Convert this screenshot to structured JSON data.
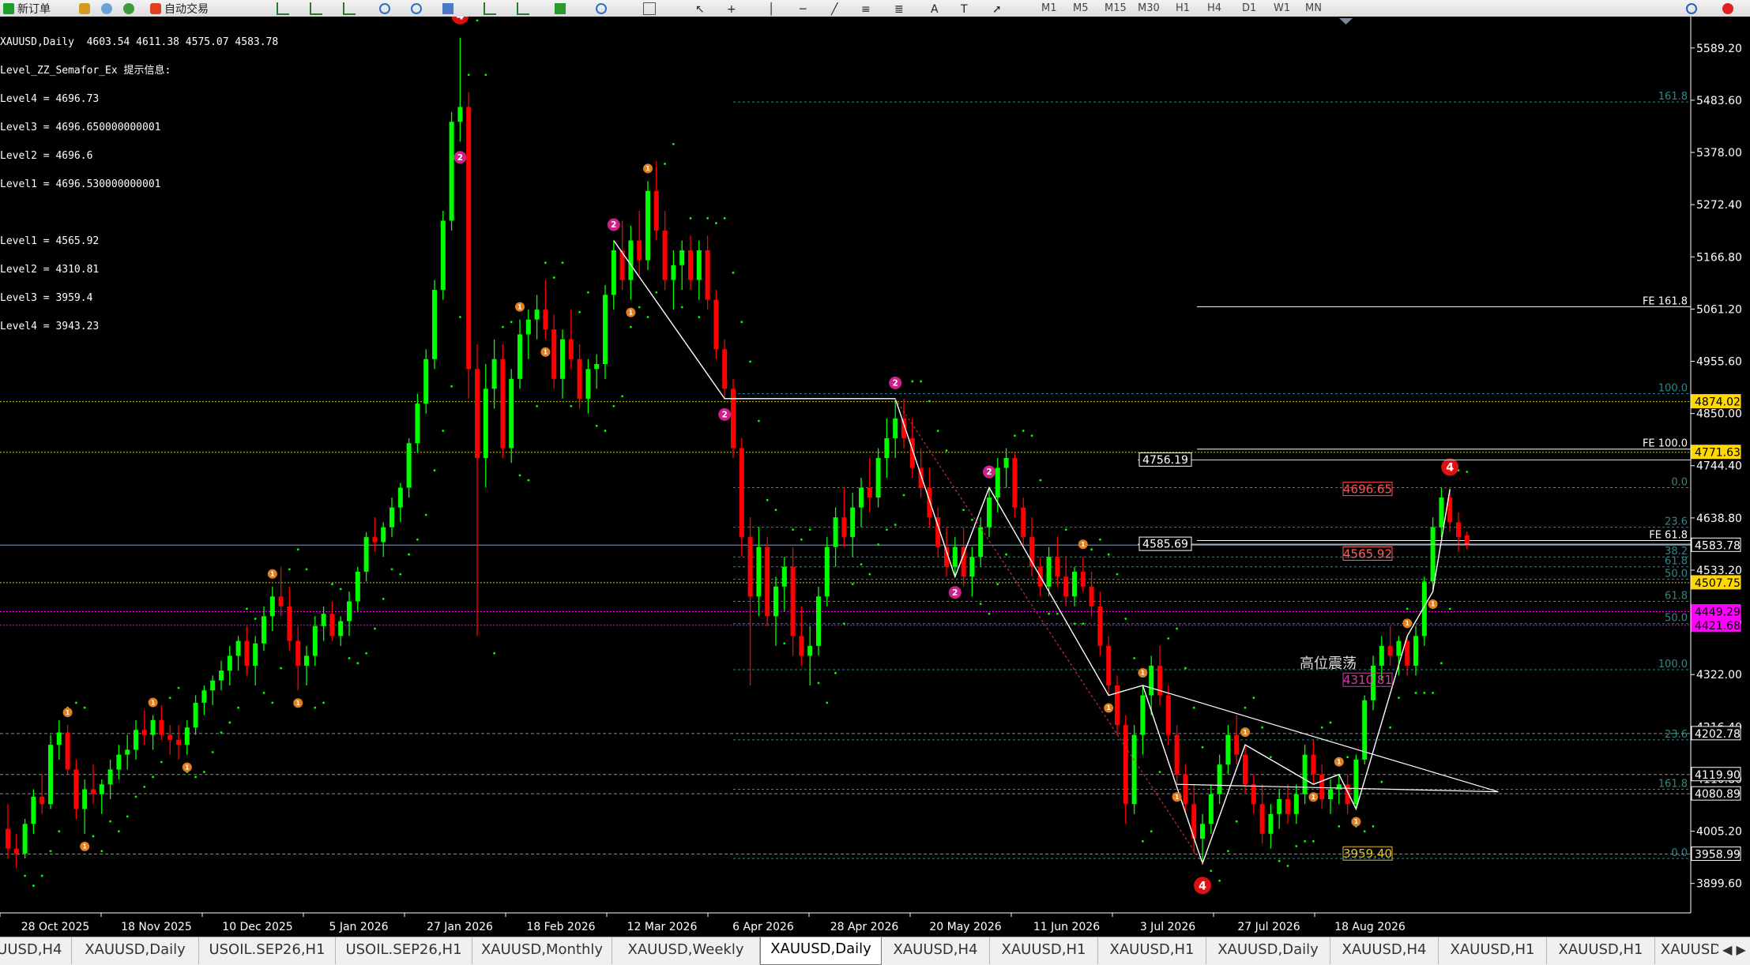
{
  "toolbar": {
    "new_order_label": "新订单",
    "auto_trading_label": "自动交易",
    "timeframes": [
      "M1",
      "M5",
      "M15",
      "M30",
      "H1",
      "H4",
      "D1",
      "W1",
      "MN"
    ]
  },
  "info": {
    "header": "XAUUSD,Daily  4603.54 4611.38 4575.07 4583.78",
    "indicator_title": "Level_ZZ_Semafor_Ex 提示信息:",
    "lines": [
      "Level4 = 4696.73",
      "Level3 = 4696.650000000001",
      "Level2 = 4696.6",
      "Level1 = 4696.530000000001",
      "",
      "Level1 = 4565.92",
      "Level2 = 4310.81",
      "Level3 = 3959.4",
      "Level4 = 3943.23"
    ]
  },
  "chart_data": {
    "type": "candlestick",
    "symbol": "XAUUSD",
    "timeframe": "Daily",
    "ohlc_current": {
      "open": 4603.54,
      "high": 4611.38,
      "low": 4575.07,
      "close": 4583.78
    },
    "ylim": [
      3840,
      5640
    ],
    "price_axis_ticks": [
      5589.2,
      5483.6,
      5378.0,
      5272.4,
      5166.8,
      5061.2,
      4955.6,
      4850.0,
      4744.4,
      4638.8,
      4533.2,
      4427.6,
      4322.0,
      4216.4,
      4110.8,
      4005.2,
      3899.6
    ],
    "time_axis_labels": [
      "28 Oct 2025",
      "18 Nov 2025",
      "10 Dec 2025",
      "5 Jan 2026",
      "27 Jan 2026",
      "18 Feb 2026",
      "12 Mar 2026",
      "6 Apr 2026",
      "28 Apr 2026",
      "20 May 2026",
      "11 Jun 2026",
      "3 Jul 2026",
      "27 Jul 2026",
      "18 Aug 2026"
    ],
    "candles": [
      [
        4010,
        4060,
        3950,
        3970
      ],
      [
        3970,
        4000,
        3930,
        3960
      ],
      [
        3960,
        4030,
        3950,
        4020
      ],
      [
        4020,
        4090,
        4000,
        4075
      ],
      [
        4075,
        4120,
        4040,
        4060
      ],
      [
        4060,
        4200,
        4050,
        4180
      ],
      [
        4180,
        4230,
        4150,
        4205
      ],
      [
        4205,
        4220,
        4120,
        4130
      ],
      [
        4130,
        4150,
        4030,
        4050
      ],
      [
        4050,
        4110,
        4000,
        4090
      ],
      [
        4090,
        4140,
        4060,
        4080
      ],
      [
        4080,
        4110,
        4040,
        4100
      ],
      [
        4100,
        4150,
        4070,
        4130
      ],
      [
        4130,
        4180,
        4110,
        4160
      ],
      [
        4160,
        4200,
        4130,
        4170
      ],
      [
        4170,
        4230,
        4150,
        4210
      ],
      [
        4210,
        4250,
        4180,
        4200
      ],
      [
        4200,
        4240,
        4170,
        4230
      ],
      [
        4230,
        4260,
        4190,
        4200
      ],
      [
        4200,
        4220,
        4160,
        4190
      ],
      [
        4190,
        4220,
        4150,
        4180
      ],
      [
        4180,
        4230,
        4160,
        4215
      ],
      [
        4215,
        4280,
        4200,
        4265
      ],
      [
        4265,
        4300,
        4240,
        4290
      ],
      [
        4290,
        4320,
        4260,
        4310
      ],
      [
        4310,
        4350,
        4290,
        4330
      ],
      [
        4330,
        4380,
        4300,
        4360
      ],
      [
        4360,
        4400,
        4330,
        4390
      ],
      [
        4390,
        4420,
        4320,
        4340
      ],
      [
        4340,
        4400,
        4300,
        4385
      ],
      [
        4385,
        4460,
        4370,
        4440
      ],
      [
        4440,
        4500,
        4410,
        4480
      ],
      [
        4480,
        4540,
        4440,
        4460
      ],
      [
        4460,
        4500,
        4370,
        4390
      ],
      [
        4390,
        4420,
        4290,
        4340
      ],
      [
        4340,
        4380,
        4300,
        4360
      ],
      [
        4360,
        4440,
        4340,
        4420
      ],
      [
        4420,
        4460,
        4390,
        4445
      ],
      [
        4445,
        4470,
        4390,
        4400
      ],
      [
        4400,
        4440,
        4380,
        4430
      ],
      [
        4430,
        4490,
        4400,
        4470
      ],
      [
        4470,
        4540,
        4450,
        4530
      ],
      [
        4530,
        4610,
        4510,
        4600
      ],
      [
        4600,
        4640,
        4570,
        4590
      ],
      [
        4590,
        4630,
        4560,
        4620
      ],
      [
        4620,
        4680,
        4600,
        4660
      ],
      [
        4660,
        4710,
        4630,
        4700
      ],
      [
        4700,
        4800,
        4680,
        4790
      ],
      [
        4790,
        4890,
        4770,
        4870
      ],
      [
        4870,
        4980,
        4850,
        4960
      ],
      [
        4960,
        5120,
        4940,
        5100
      ],
      [
        5100,
        5260,
        5080,
        5240
      ],
      [
        5240,
        5460,
        5220,
        5440
      ],
      [
        5440,
        5610,
        5400,
        5470
      ],
      [
        5470,
        5500,
        4880,
        4940
      ],
      [
        4940,
        4990,
        4400,
        4760
      ],
      [
        4760,
        4950,
        4700,
        4900
      ],
      [
        4900,
        5000,
        4860,
        4960
      ],
      [
        4960,
        4990,
        4760,
        4780
      ],
      [
        4780,
        4940,
        4750,
        4920
      ],
      [
        4920,
        5040,
        4900,
        5010
      ],
      [
        5010,
        5060,
        4960,
        5040
      ],
      [
        5040,
        5090,
        5000,
        5060
      ],
      [
        5060,
        5120,
        5000,
        5020
      ],
      [
        5020,
        5050,
        4900,
        4920
      ],
      [
        4920,
        5020,
        4880,
        5000
      ],
      [
        5000,
        5060,
        4940,
        4960
      ],
      [
        4960,
        4990,
        4860,
        4880
      ],
      [
        4880,
        4960,
        4850,
        4940
      ],
      [
        4940,
        4970,
        4900,
        4950
      ],
      [
        4950,
        5110,
        4920,
        5090
      ],
      [
        5090,
        5200,
        5060,
        5180
      ],
      [
        5180,
        5240,
        5100,
        5120
      ],
      [
        5120,
        5230,
        5080,
        5200
      ],
      [
        5200,
        5260,
        5130,
        5160
      ],
      [
        5160,
        5320,
        5140,
        5300
      ],
      [
        5300,
        5360,
        5200,
        5220
      ],
      [
        5220,
        5260,
        5100,
        5120
      ],
      [
        5120,
        5180,
        5060,
        5150
      ],
      [
        5150,
        5200,
        5100,
        5180
      ],
      [
        5180,
        5210,
        5100,
        5120
      ],
      [
        5120,
        5200,
        5080,
        5180
      ],
      [
        5180,
        5210,
        5060,
        5080
      ],
      [
        5080,
        5100,
        4960,
        4980
      ],
      [
        4980,
        5000,
        4880,
        4900
      ],
      [
        4900,
        4920,
        4760,
        4780
      ],
      [
        4780,
        4800,
        4560,
        4600
      ],
      [
        4600,
        4640,
        4300,
        4480
      ],
      [
        4480,
        4620,
        4440,
        4580
      ],
      [
        4580,
        4600,
        4420,
        4440
      ],
      [
        4440,
        4520,
        4380,
        4500
      ],
      [
        4500,
        4560,
        4450,
        4540
      ],
      [
        4540,
        4580,
        4360,
        4400
      ],
      [
        4400,
        4460,
        4340,
        4360
      ],
      [
        4360,
        4420,
        4300,
        4380
      ],
      [
        4380,
        4500,
        4360,
        4480
      ],
      [
        4480,
        4600,
        4460,
        4580
      ],
      [
        4580,
        4660,
        4540,
        4640
      ],
      [
        4640,
        4700,
        4580,
        4600
      ],
      [
        4600,
        4690,
        4560,
        4660
      ],
      [
        4660,
        4720,
        4620,
        4700
      ],
      [
        4700,
        4760,
        4650,
        4680
      ],
      [
        4680,
        4780,
        4660,
        4760
      ],
      [
        4760,
        4840,
        4720,
        4800
      ],
      [
        4800,
        4880,
        4760,
        4840
      ],
      [
        4840,
        4880,
        4780,
        4800
      ],
      [
        4800,
        4840,
        4720,
        4740
      ],
      [
        4740,
        4780,
        4680,
        4700
      ],
      [
        4700,
        4740,
        4620,
        4640
      ],
      [
        4640,
        4660,
        4560,
        4580
      ],
      [
        4580,
        4620,
        4520,
        4540
      ],
      [
        4540,
        4600,
        4520,
        4580
      ],
      [
        4580,
        4620,
        4500,
        4520
      ],
      [
        4520,
        4580,
        4480,
        4560
      ],
      [
        4560,
        4640,
        4540,
        4620
      ],
      [
        4620,
        4700,
        4600,
        4680
      ],
      [
        4680,
        4760,
        4650,
        4740
      ],
      [
        4740,
        4780,
        4700,
        4760
      ],
      [
        4760,
        4770,
        4640,
        4660
      ],
      [
        4660,
        4680,
        4580,
        4600
      ],
      [
        4600,
        4640,
        4520,
        4540
      ],
      [
        4540,
        4560,
        4480,
        4500
      ],
      [
        4500,
        4580,
        4480,
        4560
      ],
      [
        4560,
        4600,
        4500,
        4520
      ],
      [
        4520,
        4560,
        4460,
        4480
      ],
      [
        4480,
        4540,
        4460,
        4530
      ],
      [
        4530,
        4560,
        4490,
        4500
      ],
      [
        4500,
        4530,
        4440,
        4460
      ],
      [
        4460,
        4490,
        4360,
        4380
      ],
      [
        4380,
        4400,
        4280,
        4300
      ],
      [
        4300,
        4320,
        4200,
        4220
      ],
      [
        4220,
        4240,
        4020,
        4060
      ],
      [
        4060,
        4220,
        4040,
        4200
      ],
      [
        4200,
        4300,
        4160,
        4280
      ],
      [
        4280,
        4360,
        4240,
        4340
      ],
      [
        4340,
        4380,
        4260,
        4280
      ],
      [
        4280,
        4300,
        4180,
        4200
      ],
      [
        4200,
        4220,
        4100,
        4120
      ],
      [
        4120,
        4140,
        4040,
        4060
      ],
      [
        4060,
        4100,
        3960,
        3990
      ],
      [
        3990,
        4040,
        3940,
        4020
      ],
      [
        4020,
        4100,
        4000,
        4080
      ],
      [
        4080,
        4160,
        4060,
        4140
      ],
      [
        4140,
        4220,
        4120,
        4200
      ],
      [
        4200,
        4240,
        4140,
        4160
      ],
      [
        4160,
        4180,
        4080,
        4100
      ],
      [
        4100,
        4120,
        4040,
        4060
      ],
      [
        4060,
        4100,
        3980,
        4000
      ],
      [
        4000,
        4060,
        3970,
        4040
      ],
      [
        4040,
        4090,
        4010,
        4070
      ],
      [
        4070,
        4100,
        4020,
        4040
      ],
      [
        4040,
        4100,
        4020,
        4080
      ],
      [
        4080,
        4180,
        4060,
        4160
      ],
      [
        4160,
        4190,
        4100,
        4120
      ],
      [
        4120,
        4140,
        4050,
        4070
      ],
      [
        4070,
        4110,
        4040,
        4090
      ],
      [
        4090,
        4120,
        4060,
        4100
      ],
      [
        4100,
        4120,
        4040,
        4060
      ],
      [
        4060,
        4160,
        4050,
        4150
      ],
      [
        4150,
        4280,
        4140,
        4270
      ],
      [
        4270,
        4360,
        4250,
        4340
      ],
      [
        4340,
        4400,
        4310,
        4380
      ],
      [
        4380,
        4420,
        4340,
        4360
      ],
      [
        4360,
        4400,
        4320,
        4390
      ],
      [
        4390,
        4400,
        4320,
        4340
      ],
      [
        4340,
        4420,
        4320,
        4400
      ],
      [
        4400,
        4520,
        4380,
        4510
      ],
      [
        4510,
        4640,
        4490,
        4620
      ],
      [
        4620,
        4700,
        4600,
        4680
      ],
      [
        4680,
        4697,
        4610,
        4630
      ],
      [
        4630,
        4650,
        4570,
        4600
      ],
      [
        4603.54,
        4611.38,
        4575.07,
        4583.78
      ]
    ],
    "horizontal_lines": [
      {
        "price": 4874.02,
        "label": "4874.02",
        "type": "resistance"
      },
      {
        "price": 4771.63,
        "label": "4771.63",
        "type": "resistance"
      },
      {
        "price": 4583.78,
        "label": "4583.78",
        "type": "bid"
      },
      {
        "price": 4507.75,
        "label": "4507.75",
        "type": "support"
      },
      {
        "price": 4449.29,
        "label": "4449.29",
        "type": "support-magenta"
      },
      {
        "price": 4421.68,
        "label": "4421.68",
        "type": "support-magenta"
      },
      {
        "price": 4202.78,
        "label": "4202.78",
        "type": "plain"
      },
      {
        "price": 4119.9,
        "label": "4119.90",
        "type": "plain"
      },
      {
        "price": 4080.89,
        "label": "4080.89",
        "type": "plain"
      },
      {
        "price": 3958.99,
        "label": "3958.99",
        "type": "plain"
      }
    ],
    "fib_levels": [
      {
        "price": 5480,
        "label": "161.8"
      },
      {
        "price": 4890,
        "label": "100.0"
      },
      {
        "price": 4700,
        "label": "0.0"
      },
      {
        "price": 4620,
        "label": "23.6"
      },
      {
        "price": 4560,
        "label": "38.2"
      },
      {
        "price": 4540,
        "label": "61.8"
      },
      {
        "price": 4515,
        "label": "50.0"
      },
      {
        "price": 4470,
        "label": "61.8"
      },
      {
        "price": 4425,
        "label": "50.0"
      },
      {
        "price": 4332,
        "label": "100.0"
      },
      {
        "price": 4190,
        "label": "23.6"
      },
      {
        "price": 4090,
        "label": "161.8"
      },
      {
        "price": 3950,
        "label": "0.0"
      }
    ],
    "fe_levels": [
      {
        "price": 5066,
        "label": "FE 161.8"
      },
      {
        "price": 4778,
        "label": "FE 100.0"
      },
      {
        "price": 4593,
        "label": "FE 61.8"
      }
    ],
    "price_boxes": [
      {
        "price": 4756.19,
        "label": "4756.19"
      },
      {
        "price": 4585.69,
        "label": "4585.69"
      }
    ],
    "semafor_level_labels": [
      {
        "label": "4696.65",
        "price": 4696.65
      },
      {
        "label": "4565.92",
        "price": 4565.92
      },
      {
        "label": "4310.81",
        "price": 4310.81
      },
      {
        "label": "3959.40",
        "price": 3959.4
      }
    ],
    "annotation": "高位震荡",
    "semafor_markers": [
      {
        "i": 53,
        "pos": "high",
        "level": "4"
      },
      {
        "i": 53,
        "pos": "low",
        "level": "2"
      },
      {
        "i": 71,
        "pos": "high",
        "level": "2"
      },
      {
        "i": 84,
        "pos": "low",
        "level": "2"
      },
      {
        "i": 104,
        "pos": "high",
        "level": "2"
      },
      {
        "i": 111,
        "pos": "low",
        "level": "2"
      },
      {
        "i": 115,
        "pos": "high",
        "level": "2"
      },
      {
        "i": 140,
        "pos": "low",
        "level": "4"
      },
      {
        "i": 169,
        "pos": "high",
        "level": "4"
      },
      {
        "i": 7,
        "pos": "high",
        "level": "1"
      },
      {
        "i": 9,
        "pos": "low",
        "level": "1"
      },
      {
        "i": 17,
        "pos": "high",
        "level": "1"
      },
      {
        "i": 21,
        "pos": "low",
        "level": "1"
      },
      {
        "i": 31,
        "pos": "high",
        "level": "1"
      },
      {
        "i": 34,
        "pos": "low",
        "level": "1"
      },
      {
        "i": 60,
        "pos": "high",
        "level": "1"
      },
      {
        "i": 63,
        "pos": "low",
        "level": "1"
      },
      {
        "i": 73,
        "pos": "low",
        "level": "1"
      },
      {
        "i": 75,
        "pos": "high",
        "level": "1"
      },
      {
        "i": 126,
        "pos": "high",
        "level": "1"
      },
      {
        "i": 129,
        "pos": "low",
        "level": "1"
      },
      {
        "i": 133,
        "pos": "high",
        "level": "1"
      },
      {
        "i": 137,
        "pos": "low",
        "level": "1"
      },
      {
        "i": 145,
        "pos": "high",
        "level": "1"
      },
      {
        "i": 153,
        "pos": "low",
        "level": "1"
      },
      {
        "i": 156,
        "pos": "high",
        "level": "1"
      },
      {
        "i": 158,
        "pos": "low",
        "level": "1"
      },
      {
        "i": 164,
        "pos": "high",
        "level": "1"
      },
      {
        "i": 167,
        "pos": "low",
        "level": "1"
      }
    ]
  },
  "tabs": [
    {
      "label": "XAUUSD,H4"
    },
    {
      "label": "XAUUSD,Daily"
    },
    {
      "label": "USOIL.SEP26,H1"
    },
    {
      "label": "USOIL.SEP26,H1"
    },
    {
      "label": "XAUUSD,Monthly"
    },
    {
      "label": "XAUUSD,Weekly"
    },
    {
      "label": "XAUUSD,Daily",
      "active": true
    },
    {
      "label": "XAUUSD,H4"
    },
    {
      "label": "XAUUSD,H1"
    },
    {
      "label": "XAUUSD,H1"
    },
    {
      "label": "XAUUSD,Daily"
    },
    {
      "label": "XAUUSD,H4"
    },
    {
      "label": "XAUUSD,H1"
    },
    {
      "label": "XAUUSD,H1"
    },
    {
      "label": "XAUUSD"
    }
  ],
  "tab_arrows": "◀ ▶",
  "colors": {
    "bull": "#00ff00",
    "bear": "#ff0000",
    "axis": "#ffffff",
    "fib": "#2a8a8a",
    "level": "#c8c800",
    "magenta": "#ff00ff"
  }
}
